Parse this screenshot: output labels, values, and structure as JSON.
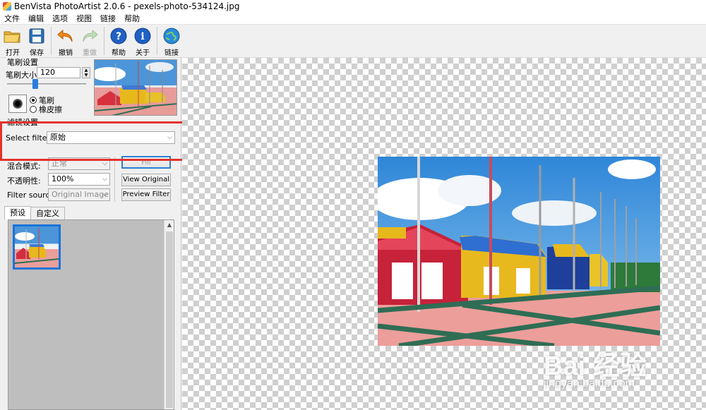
{
  "window": {
    "title": "BenVista PhotoArtist 2.0.6 - pexels-photo-534124.jpg"
  },
  "menu": [
    "文件",
    "编辑",
    "选项",
    "视图",
    "链接",
    "帮助"
  ],
  "toolbar": {
    "open": "打开",
    "save": "保存",
    "undo": "撤销",
    "redo": "重做",
    "help": "帮助",
    "about": "关于",
    "link": "链接"
  },
  "brush": {
    "group_title": "笔刷设置",
    "size_label": "笔刷大小:",
    "size_value": "120",
    "size_slider_fraction": 0.32,
    "mode_brush": "笔刷",
    "mode_eraser": "橡皮擦",
    "selected_mode": "笔刷"
  },
  "filter": {
    "group_title": "滤镜设置",
    "select_label": "Select filter:",
    "selected": "原始",
    "blend_label": "混合模式:",
    "blend_value": "正常",
    "opacity_label": "不透明性:",
    "opacity_value": "100%",
    "source_label": "Filter source:",
    "source_value": "Original Image",
    "apply_button": "Fill",
    "view_original_button": "View Original",
    "preview_button": "Preview Filter"
  },
  "tabs": [
    "预设",
    "自定义"
  ],
  "active_tab": "预设",
  "watermark": {
    "brand": "Bai 经验",
    "url": "jingyan.baidu.com"
  },
  "colors": {
    "accent": "#2b7fd6",
    "annotation": "#e3332c"
  }
}
